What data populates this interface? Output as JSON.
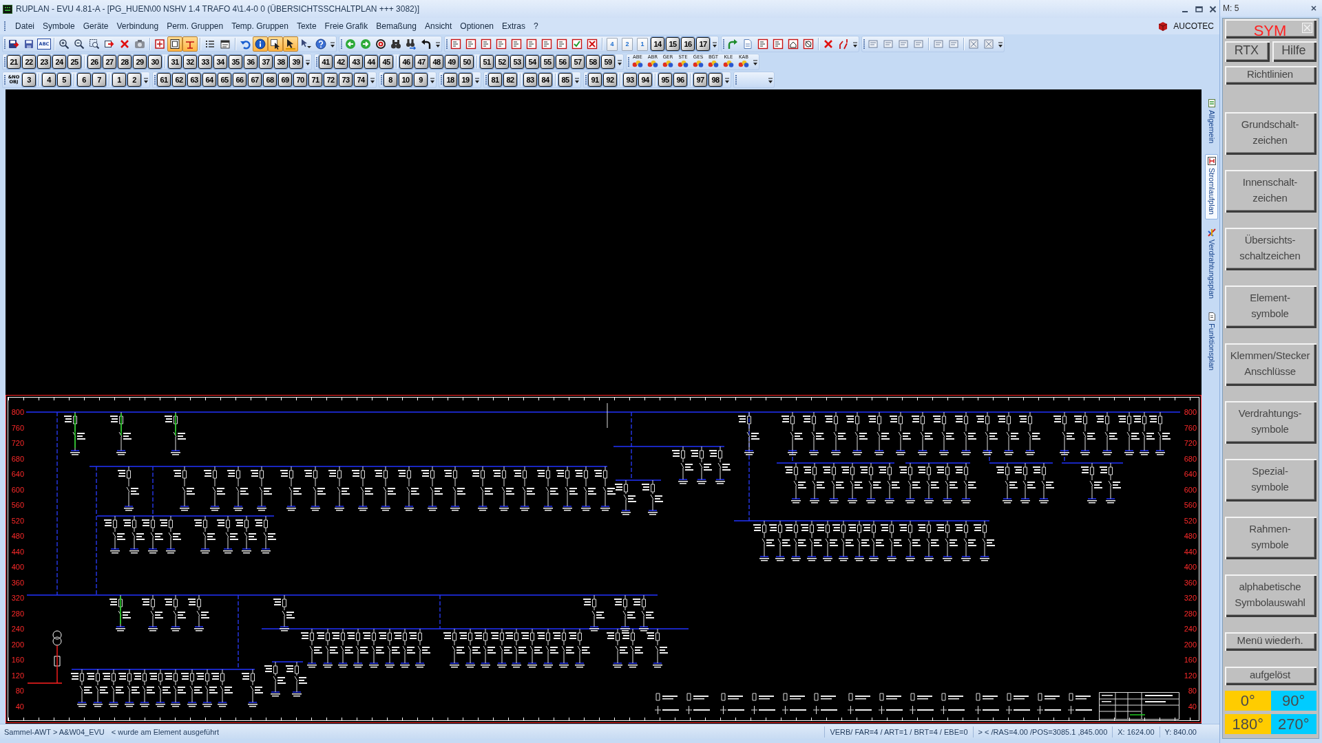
{
  "window": {
    "title": "RUPLAN - EVU 4.81-A - [PG_HUEN\\00 NSHV 1.4 TRAFO 4\\1.4-0 0 (ÜBERSICHTSSCHALTPLAN +++ 3082)]",
    "brand": "AUCOTEC"
  },
  "menu": [
    "Datei",
    "Symbole",
    "Geräte",
    "Verbindung",
    "Perm. Gruppen",
    "Temp. Gruppen",
    "Texte",
    "Freie Grafik",
    "Bemaßung",
    "Ansicht",
    "Optionen",
    "Extras",
    "?"
  ],
  "toolbar_1": [
    {
      "groups": [
        [
          {
            "kind": "icon",
            "pressed": false
          },
          {
            "kind": "icon",
            "pressed": false
          },
          {
            "kind": "text",
            "label": "ABC"
          }
        ],
        [
          {
            "kind": "icon",
            "pressed": false
          },
          {
            "kind": "icon",
            "pressed": false
          },
          {
            "kind": "icon",
            "pressed": false
          },
          {
            "kind": "icon",
            "pressed": false
          },
          {
            "kind": "icon",
            "pressed": false
          },
          {
            "kind": "icon",
            "pressed": false
          }
        ],
        [
          {
            "kind": "icon",
            "pressed": false
          },
          {
            "kind": "icon",
            "pressed": true
          },
          {
            "kind": "icon",
            "pressed": true
          }
        ],
        [
          {
            "kind": "icon",
            "pressed": false
          },
          {
            "kind": "icon",
            "pressed": false
          }
        ],
        [
          {
            "kind": "icon",
            "pressed": false
          },
          {
            "kind": "icon",
            "pressed": true
          },
          {
            "kind": "icon",
            "pressed": true
          },
          {
            "kind": "icon",
            "pressed": true
          },
          {
            "kind": "icon",
            "pressed": false
          },
          {
            "kind": "icon",
            "pressed": false
          }
        ]
      ]
    },
    {
      "groups": [
        [
          {
            "kind": "icon",
            "pressed": false
          },
          {
            "kind": "icon",
            "pressed": false
          },
          {
            "kind": "icon",
            "pressed": false
          },
          {
            "kind": "icon",
            "pressed": false
          },
          {
            "kind": "icon",
            "pressed": false
          },
          {
            "kind": "icon",
            "pressed": false
          }
        ]
      ]
    },
    {
      "groups": [
        [
          {
            "kind": "icon",
            "pressed": false
          },
          {
            "kind": "icon",
            "pressed": false
          },
          {
            "kind": "icon",
            "pressed": false
          },
          {
            "kind": "icon",
            "pressed": false
          },
          {
            "kind": "icon",
            "pressed": false
          },
          {
            "kind": "icon",
            "pressed": false
          },
          {
            "kind": "icon",
            "pressed": false
          },
          {
            "kind": "icon",
            "pressed": false
          },
          {
            "kind": "icon",
            "pressed": false
          },
          {
            "kind": "icon",
            "pressed": false
          }
        ],
        [
          {
            "kind": "page",
            "label": "4"
          },
          {
            "kind": "page",
            "label": "2"
          },
          {
            "kind": "page",
            "label": "1"
          },
          {
            "kind": "number",
            "label": "14"
          },
          {
            "kind": "number",
            "label": "15"
          },
          {
            "kind": "number",
            "label": "16"
          },
          {
            "kind": "number",
            "label": "17"
          }
        ]
      ]
    },
    {
      "groups": [
        [
          {
            "kind": "icon",
            "pressed": false
          },
          {
            "kind": "icon",
            "pressed": false
          },
          {
            "kind": "icon",
            "pressed": false
          },
          {
            "kind": "icon",
            "pressed": false
          },
          {
            "kind": "icon",
            "pressed": false
          },
          {
            "kind": "icon",
            "pressed": false
          }
        ],
        [
          {
            "kind": "icon",
            "pressed": false
          },
          {
            "kind": "icon",
            "pressed": false
          }
        ]
      ]
    },
    {
      "groups": [
        [
          {
            "kind": "icon",
            "pressed": false
          },
          {
            "kind": "icon",
            "pressed": false
          },
          {
            "kind": "icon",
            "pressed": false
          },
          {
            "kind": "icon",
            "pressed": false
          }
        ],
        [
          {
            "kind": "icon",
            "pressed": false
          },
          {
            "kind": "icon",
            "pressed": false
          }
        ],
        [
          {
            "kind": "icon",
            "pressed": false
          },
          {
            "kind": "icon",
            "pressed": false
          }
        ]
      ]
    }
  ],
  "toolbar_2": [
    {
      "kind": "number",
      "groups": [
        [
          "21",
          "22",
          "23",
          "24",
          "25"
        ],
        [
          "26",
          "27",
          "28",
          "29",
          "30"
        ],
        [
          "31",
          "32",
          "33",
          "34",
          "35",
          "36",
          "37",
          "38",
          "39"
        ]
      ]
    },
    {
      "kind": "number",
      "groups": [
        [
          "41",
          "42",
          "43",
          "44",
          "45"
        ],
        [
          "46",
          "47",
          "48",
          "49",
          "50"
        ],
        [
          "51",
          "52",
          "53",
          "54",
          "55",
          "56",
          "57",
          "58",
          "59"
        ]
      ]
    },
    {
      "kind": "symbol",
      "groups": [
        [
          "ABE",
          "ABR",
          "GER",
          "STE",
          "GES",
          "BGT",
          "KLE",
          "KAB"
        ]
      ]
    }
  ],
  "toolbar_3": [
    {
      "kind": "number",
      "lead": "&NO OBJ",
      "groups": [
        [
          "3"
        ],
        [
          "4",
          "5"
        ],
        [
          "6",
          "7"
        ],
        [
          "1",
          "2"
        ]
      ]
    },
    {
      "kind": "number",
      "groups": [
        [
          "61",
          "62",
          "63",
          "64",
          "65",
          "66",
          "67",
          "68",
          "69",
          "70",
          "71",
          "72",
          "73",
          "74"
        ]
      ]
    },
    {
      "kind": "number",
      "groups": [
        [
          "8",
          "10",
          "9"
        ]
      ]
    },
    {
      "kind": "number",
      "groups": [
        [
          "18",
          "19"
        ]
      ]
    },
    {
      "kind": "number",
      "groups": [
        [
          "81",
          "82"
        ],
        [
          "83",
          "84"
        ],
        [
          "85"
        ]
      ]
    },
    {
      "kind": "number",
      "groups": [
        [
          "91",
          "92"
        ],
        [
          "93",
          "94"
        ],
        [
          "95",
          "96"
        ],
        [
          "97",
          "98"
        ]
      ]
    }
  ],
  "side_tabs": [
    {
      "label": "Allgemein",
      "selected": false
    },
    {
      "label": "Stromlaufplan",
      "selected": true
    },
    {
      "label": "Verdrahtungsplan",
      "selected": false
    },
    {
      "label": "Funktionsplan",
      "selected": false
    }
  ],
  "sheet": {
    "left_ruler": [
      "800",
      "760",
      "720",
      "680",
      "640",
      "600",
      "560",
      "520",
      "480",
      "440",
      "400",
      "360",
      "320",
      "280",
      "240",
      "200",
      "160",
      "120",
      "80",
      "40"
    ],
    "right_ruler": [
      "800",
      "760",
      "720",
      "680",
      "640",
      "600",
      "560",
      "520",
      "480",
      "440",
      "400",
      "360",
      "320",
      "280",
      "240",
      "200",
      "160",
      "120",
      "80",
      "40"
    ]
  },
  "status_bar": {
    "left": [
      "Sammel-AWT > A&W04_EVU",
      "< wurde am Element ausgeführt"
    ],
    "right": [
      "VERB/ FAR=4 / ART=1 / BRT=4 / EBE=0",
      "> < /RAS=4.00 /POS=3085.1 ,845.000",
      "X: 1624.00",
      "Y: 840.00"
    ]
  },
  "panel": {
    "title": "M: 5",
    "mode": "SYM",
    "pair": [
      "RTX",
      "Hilfe"
    ],
    "guide": "Richtlinien",
    "categories": [
      "Grundschalt-\nzeichen",
      "Innenschalt-\nzeichen",
      "Übersichts-\nschaltzeichen",
      "Element-\nsymbole",
      "Klemmen/Stecker\nAnschlüsse",
      "Verdrahtungs-\nsymbole",
      "Spezial-\nsymbole",
      "Rahmen-\nsymbole",
      "alphabetische\nSymbolauswahl"
    ],
    "actions": [
      "Menü wiederh.",
      "aufgelöst"
    ],
    "angles": [
      {
        "label": "0°",
        "color": "#ffcc00"
      },
      {
        "label": "90°",
        "color": "#00ccff"
      },
      {
        "label": "180°",
        "color": "#ffcc00"
      },
      {
        "label": "270°",
        "color": "#00ccff"
      }
    ]
  }
}
